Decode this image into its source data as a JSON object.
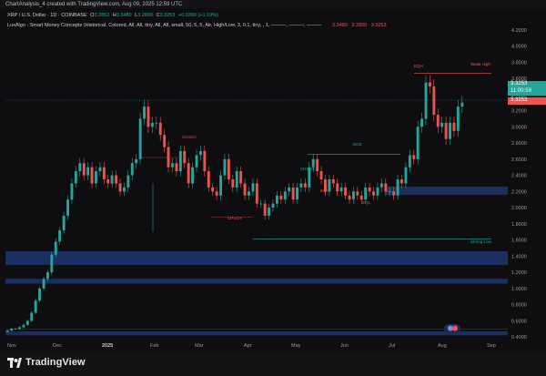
{
  "caption": "ChartAnalysis_4 created with TradingView.com, Aug 09, 2025 12:59 UTC",
  "legend": {
    "symbol": "XRP / U.S. Dollar · 1D · COINBASE",
    "o_label": "O",
    "o": "3.2862",
    "h_label": "H",
    "h": "3.3480",
    "l_label": "L",
    "l": "3.2800",
    "c_label": "C",
    "c": "3.3253",
    "change": "+0.0390 (+1.19%)",
    "indicator": "LuxAlgo - Smart Money Concepts (Historical, Colored, All, All, tiny, All, All, small, 50, 5, 5, Atr, High/Low, 3, 0.1, tiny, , 1, ———, ———, ———",
    "indicator_values": [
      "3.3480",
      "3.2800",
      "3.3253"
    ]
  },
  "price_tags": {
    "last": "3.3253",
    "countdown": "11:00:59",
    "last2": "3.3253"
  },
  "annotations": {
    "bos": "BOS",
    "weak_high": "Weak High",
    "strong_low": "Strong Low",
    "choch": "CHoCH",
    "eqh": "EQH",
    "eql": "EQL"
  },
  "colors": {
    "up": "#26a69a",
    "down": "#ef5350",
    "zone": "#1e3a8a",
    "background": "#0e0e10"
  },
  "branding": {
    "name": "TradingView"
  },
  "chart_data": {
    "type": "candlestick",
    "title": "XRP / U.S. Dollar · 1D · COINBASE",
    "xlabel": "",
    "ylabel": "",
    "ylim": [
      0.3,
      4.4
    ],
    "y_ticks": [
      0.4,
      0.6,
      0.8,
      1.0,
      1.2,
      1.4,
      1.6,
      1.8,
      2.0,
      2.2,
      2.4,
      2.6,
      2.8,
      3.0,
      3.2,
      3.4,
      3.6,
      3.8,
      4.0,
      4.2
    ],
    "x_ticks": [
      "Nov",
      "Dec",
      "2025",
      "Feb",
      "Mar",
      "Apr",
      "May",
      "Jun",
      "Jul",
      "Aug",
      "Sep"
    ],
    "grid": false,
    "series": [
      {
        "values": [
          0.48,
          0.5,
          0.5,
          0.52,
          0.55,
          0.6,
          0.7,
          0.85,
          1.0,
          1.12,
          1.2,
          1.42,
          1.58,
          1.72,
          1.9,
          2.1,
          2.3,
          2.45,
          2.55,
          2.4,
          2.5,
          2.3,
          2.45,
          2.5,
          2.35,
          2.3,
          2.4,
          2.3,
          2.2,
          2.25,
          2.4,
          2.55,
          2.6,
          3.1,
          3.25,
          3.0,
          3.05,
          3.05,
          2.9,
          2.75,
          2.5,
          2.55,
          2.45,
          2.7,
          2.55,
          2.3,
          2.5,
          2.65,
          2.7,
          2.45,
          2.25,
          2.2,
          2.15,
          2.4,
          2.6,
          2.35,
          2.25,
          2.45,
          2.3,
          2.15,
          2.2,
          2.3,
          2.05,
          2.05,
          1.9,
          2.0,
          2.05,
          2.15,
          2.1,
          2.2,
          2.25,
          2.1,
          2.25,
          2.3,
          2.25,
          2.5,
          2.6,
          2.45,
          2.35,
          2.2,
          2.35,
          2.3,
          2.2,
          2.25,
          2.15,
          2.1,
          2.2,
          2.15,
          2.1,
          2.25,
          2.2,
          2.15,
          2.25,
          2.3,
          2.2,
          2.2,
          2.15,
          2.35,
          2.3,
          2.5,
          2.65,
          2.6,
          3.0,
          3.1,
          3.55,
          3.5,
          3.15,
          3.0,
          3.05,
          2.85,
          3.05,
          2.95,
          3.25,
          3.3
        ]
      }
    ],
    "zones": [
      {
        "kind": "supply",
        "low": 2.16,
        "high": 2.26,
        "start": "Jul"
      },
      {
        "kind": "demand",
        "low": 1.29,
        "high": 1.46,
        "start": "Nov"
      },
      {
        "kind": "demand",
        "low": 1.06,
        "high": 1.12,
        "start": "Nov"
      },
      {
        "kind": "demand",
        "low": 0.42,
        "high": 0.47,
        "start": "Nov"
      }
    ],
    "levels": [
      {
        "label": "Weak High",
        "value": 3.66
      },
      {
        "label": "Strong Low",
        "value": 1.61
      },
      {
        "label": "BOS",
        "value": 2.66
      }
    ]
  }
}
